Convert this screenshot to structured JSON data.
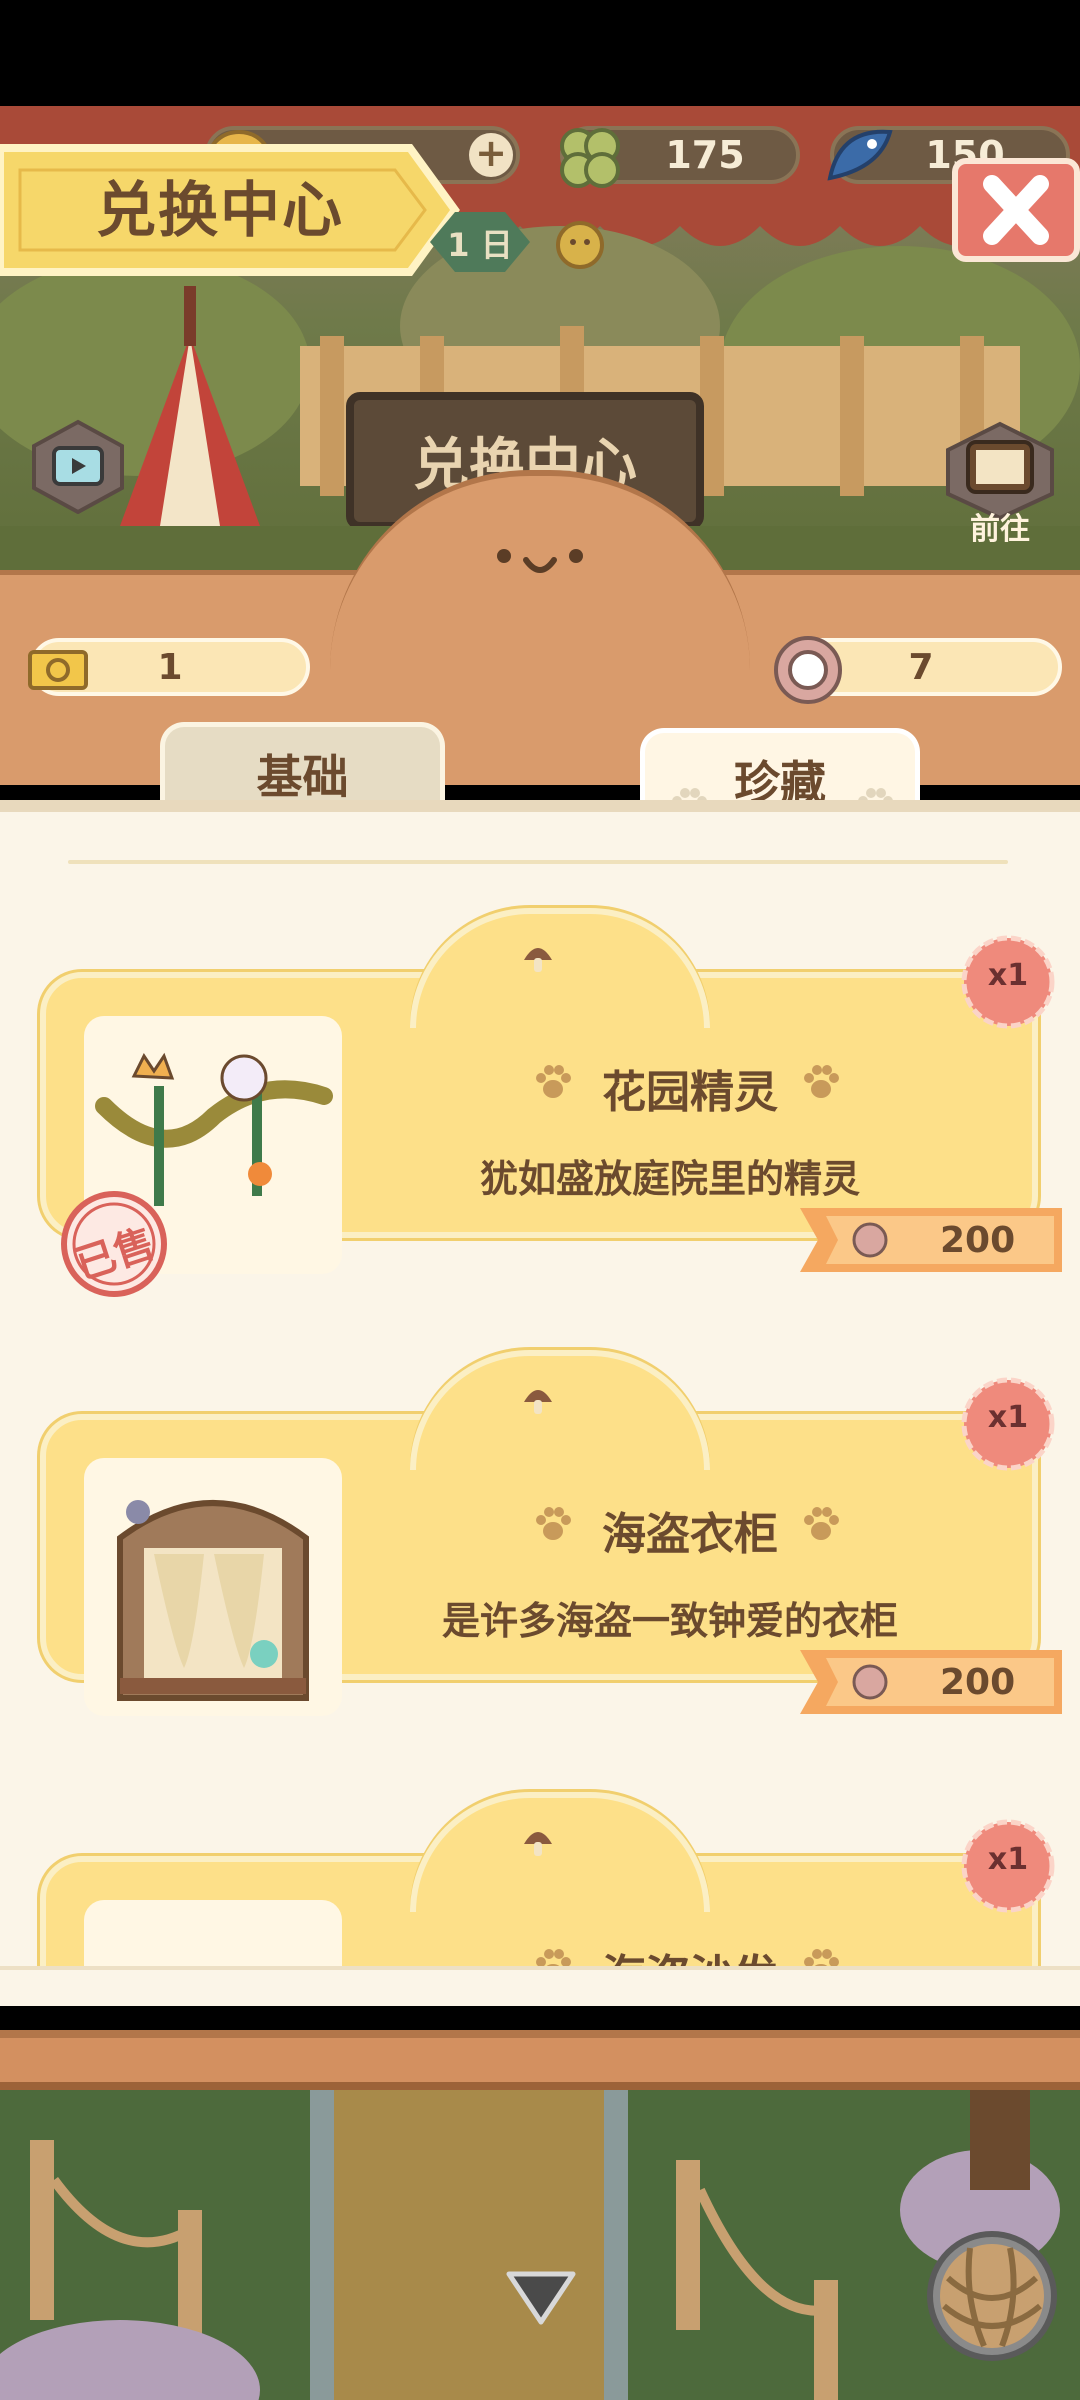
{
  "header": {
    "title": "兑换中心",
    "currencies": [
      {
        "name": "coin",
        "value": "",
        "icon": "coin-icon"
      },
      {
        "name": "clover",
        "value": "175",
        "icon": "clover-icon"
      },
      {
        "name": "fish",
        "value": "150",
        "icon": "fish-icon"
      }
    ],
    "date_text": "1 日",
    "sign_text": "兑换中心",
    "go_label": "前往"
  },
  "counters": {
    "ticket": "1",
    "token": "7"
  },
  "tabs": [
    {
      "label": "基础",
      "active": false
    },
    {
      "label": "珍藏",
      "active": true
    }
  ],
  "items": [
    {
      "name": "花园精灵",
      "desc": "犹如盛放庭院里的精灵",
      "price": "200",
      "qty": "x1",
      "sold": true,
      "sold_label": "已售"
    },
    {
      "name": "海盗衣柜",
      "desc": "是许多海盗一致钟爱的衣柜",
      "price": "200",
      "qty": "x1",
      "sold": false
    },
    {
      "name": "海盗沙发",
      "desc": "",
      "price": "",
      "qty": "x1",
      "sold": false
    }
  ],
  "colors": {
    "card": "#fde089",
    "panel": "#d99b6c",
    "price_tag": "#f5a860",
    "badge": "#ef8a7c",
    "close": "#e6786b"
  }
}
